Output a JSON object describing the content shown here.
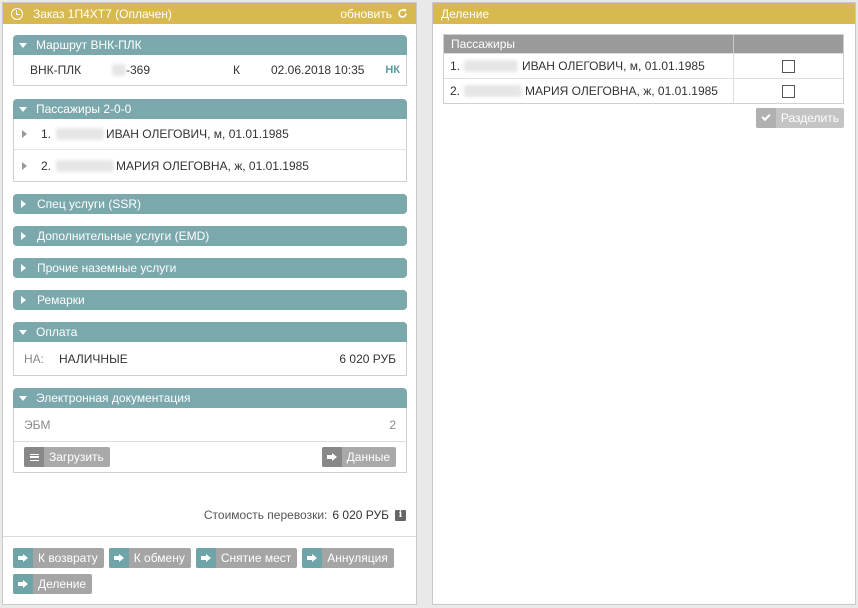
{
  "left_panel": {
    "title": "Заказ 1П4ХТ7 (Оплачен)",
    "refresh_label": "обновить"
  },
  "route": {
    "header": "Маршрут ВНК-ПЛК",
    "segment": "ВНК-ПЛК",
    "flight_suffix": "-369",
    "class": "К",
    "datetime": "02.06.2018 10:35",
    "status": "НК"
  },
  "passengers": {
    "header": "Пассажиры 2-0-0",
    "items": [
      {
        "num": "1.",
        "name": "ИВАН ОЛЕГОВИЧ, м, 01.01.1985"
      },
      {
        "num": "2.",
        "name": "МАРИЯ ОЛЕГОВНА, ж, 01.01.1985"
      }
    ]
  },
  "collapsed_sections": {
    "ssr": "Спец услуги (SSR)",
    "emd": "Дополнительные услуги (EMD)",
    "ground": "Прочие наземные услуги",
    "remarks": "Ремарки"
  },
  "payment": {
    "header": "Оплата",
    "code": "НА:",
    "method": "НАЛИЧНЫЕ",
    "amount": "6 020 РУБ"
  },
  "edocs": {
    "header": "Электронная документация",
    "label": "ЭБМ",
    "count": "2",
    "upload_label": "Загрузить",
    "data_label": "Данные"
  },
  "cost": {
    "label": "Стоимость перевозки:",
    "value": "6 020 РУБ"
  },
  "actions": {
    "refund": "К возврату",
    "exchange": "К обмену",
    "unseat": "Снятие мест",
    "annul": "Аннуляция",
    "split": "Деление"
  },
  "right_panel": {
    "title": "Деление",
    "table_header": "Пассажиры",
    "rows": [
      {
        "num": "1.",
        "name": "ИВАН ОЛЕГОВИЧ, м, 01.01.1985",
        "checked": false
      },
      {
        "num": "2.",
        "name": "МАРИЯ ОЛЕГОВНА, ж, 01.01.1985",
        "checked": false
      }
    ],
    "split_button": "Разделить"
  },
  "colors": {
    "header_gold": "#d8b94f",
    "section_teal": "#7aa8ac",
    "button_gray": "#a9a9a9"
  }
}
